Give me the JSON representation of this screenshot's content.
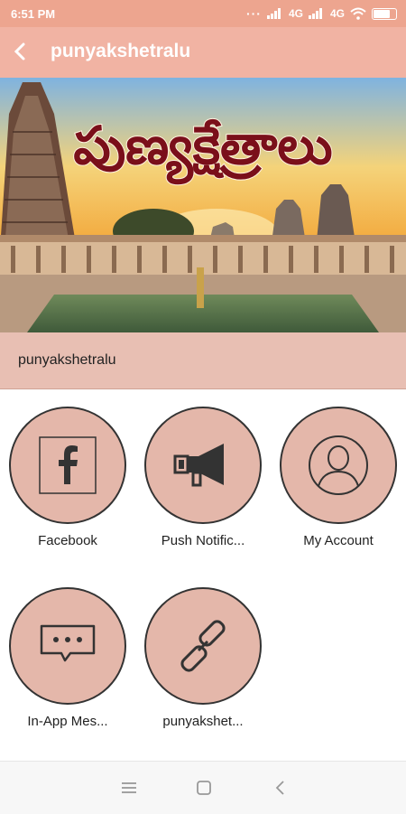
{
  "status_bar": {
    "time": "6:51 PM",
    "network_1": "4G",
    "network_2": "4G"
  },
  "toolbar": {
    "title": "punyakshetralu"
  },
  "banner": {
    "telugu_title": "పుణ్యక్షేత్రాలు"
  },
  "caption": "punyakshetralu",
  "tiles": [
    {
      "label": "Facebook",
      "icon": "facebook-icon"
    },
    {
      "label": "Push Notific...",
      "icon": "megaphone-icon"
    },
    {
      "label": "My Account",
      "icon": "user-icon"
    },
    {
      "label": "In-App Mes...",
      "icon": "chat-bubble-icon"
    },
    {
      "label": "punyakshet...",
      "icon": "link-icon"
    }
  ],
  "colors": {
    "status_bar": "#eda58f",
    "toolbar": "#f1b3a3",
    "caption_bar": "#e8bfb3",
    "tile": "#e4b7aa"
  }
}
